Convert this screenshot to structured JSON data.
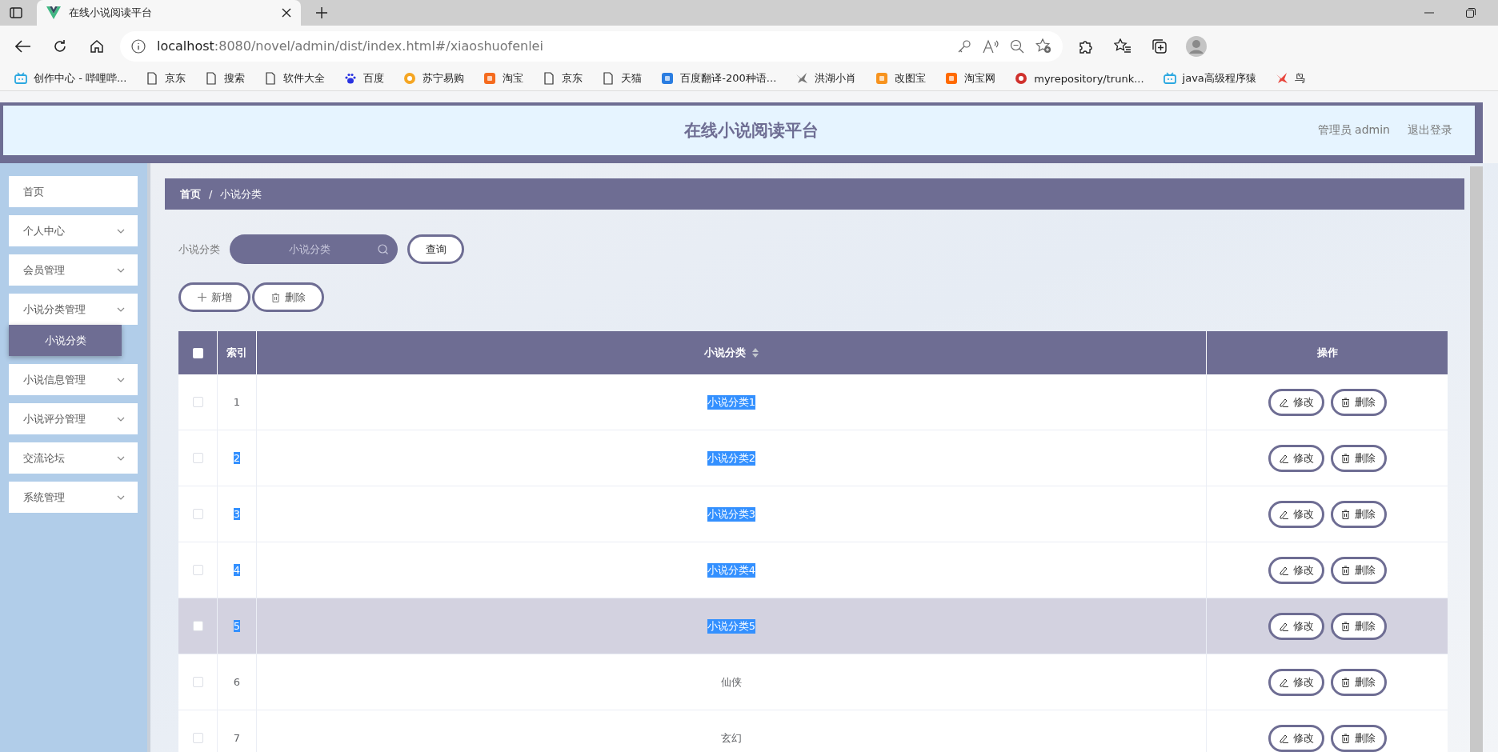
{
  "browser": {
    "tab": {
      "title": "在线小说阅读平台"
    },
    "url_host": "localhost",
    "url_path": ":8080/novel/admin/dist/index.html#/xiaoshuofenlei",
    "bookmarks": [
      {
        "kind": "tv",
        "color": "#2aa7e0",
        "label": "创作中心 - 哔哩哔..."
      },
      {
        "kind": "page",
        "label": "京东"
      },
      {
        "kind": "page",
        "label": "搜索"
      },
      {
        "kind": "page",
        "label": "软件大全"
      },
      {
        "kind": "paw",
        "color": "#2932e1",
        "label": "百度"
      },
      {
        "kind": "circle",
        "color": "#f5a623",
        "label": "苏宁易购"
      },
      {
        "kind": "square",
        "color": "#f56b1e",
        "label": "淘宝"
      },
      {
        "kind": "page",
        "label": "京东"
      },
      {
        "kind": "page",
        "label": "天猫"
      },
      {
        "kind": "square",
        "color": "#2a7de1",
        "label": "百度翻译-200种语..."
      },
      {
        "kind": "bird",
        "color": "#777777",
        "label": "洪湖小肖"
      },
      {
        "kind": "square",
        "color": "#f7931e",
        "label": "改图宝"
      },
      {
        "kind": "square",
        "color": "#ff6a00",
        "label": "淘宝网"
      },
      {
        "kind": "circle",
        "color": "#d0312d",
        "label": "myrepository/trunk..."
      },
      {
        "kind": "tv",
        "color": "#2aa7e0",
        "label": "java高级程序猿"
      },
      {
        "kind": "bird",
        "color": "#e8453c",
        "label": "鸟"
      }
    ]
  },
  "header": {
    "title": "在线小说阅读平台",
    "user": "管理员 admin",
    "logout": "退出登录"
  },
  "sidebar": {
    "items": [
      {
        "kind": "link",
        "label": "首页"
      },
      {
        "kind": "menu",
        "label": "个人中心"
      },
      {
        "kind": "menu",
        "label": "会员管理"
      },
      {
        "kind": "menu",
        "label": "小说分类管理",
        "children": [
          {
            "label": "小说分类",
            "selected": true
          }
        ]
      },
      {
        "kind": "menu",
        "label": "小说信息管理"
      },
      {
        "kind": "menu",
        "label": "小说评分管理"
      },
      {
        "kind": "menu",
        "label": "交流论坛"
      },
      {
        "kind": "menu",
        "label": "系统管理"
      }
    ]
  },
  "breadcrumb": {
    "items": [
      "首页",
      "小说分类"
    ],
    "separator": "/"
  },
  "search": {
    "label": "小说分类",
    "placeholder": "小说分类",
    "button": "查询"
  },
  "actions": [
    {
      "kind": "add",
      "label": "新增"
    },
    {
      "kind": "delete",
      "label": "删除"
    }
  ],
  "table": {
    "columns": [
      {
        "kind": "check",
        "checked": false
      },
      {
        "kind": "text",
        "label": "索引"
      },
      {
        "kind": "sort",
        "label": "小说分类"
      },
      {
        "kind": "text",
        "label": "操作"
      }
    ],
    "rows": [
      {
        "checked": false,
        "hovered": false,
        "index": "1",
        "index_highlighted": false,
        "category": "小说分类1",
        "category_highlighted": true,
        "actions": [
          {
            "kind": "edit",
            "label": "修改"
          },
          {
            "kind": "delete",
            "label": "删除"
          }
        ]
      },
      {
        "checked": false,
        "hovered": false,
        "index": "2",
        "index_highlighted": true,
        "category": "小说分类2",
        "category_highlighted": true,
        "actions": [
          {
            "kind": "edit",
            "label": "修改"
          },
          {
            "kind": "delete",
            "label": "删除"
          }
        ]
      },
      {
        "checked": false,
        "hovered": false,
        "index": "3",
        "index_highlighted": true,
        "category": "小说分类3",
        "category_highlighted": true,
        "actions": [
          {
            "kind": "edit",
            "label": "修改"
          },
          {
            "kind": "delete",
            "label": "删除"
          }
        ]
      },
      {
        "checked": false,
        "hovered": false,
        "index": "4",
        "index_highlighted": true,
        "category": "小说分类4",
        "category_highlighted": true,
        "actions": [
          {
            "kind": "edit",
            "label": "修改"
          },
          {
            "kind": "delete",
            "label": "删除"
          }
        ]
      },
      {
        "checked": false,
        "hovered": true,
        "index": "5",
        "index_highlighted": true,
        "category": "小说分类5",
        "category_highlighted": true,
        "actions": [
          {
            "kind": "edit",
            "label": "修改"
          },
          {
            "kind": "delete",
            "label": "删除"
          }
        ]
      },
      {
        "checked": false,
        "hovered": false,
        "index": "6",
        "index_highlighted": false,
        "category": "仙侠",
        "category_highlighted": false,
        "actions": [
          {
            "kind": "edit",
            "label": "修改"
          },
          {
            "kind": "delete",
            "label": "删除"
          }
        ]
      },
      {
        "checked": false,
        "hovered": false,
        "index": "7",
        "index_highlighted": false,
        "category": "玄幻",
        "category_highlighted": false,
        "actions": [
          {
            "kind": "edit",
            "label": "修改"
          },
          {
            "kind": "delete",
            "label": "删除"
          }
        ]
      }
    ]
  }
}
